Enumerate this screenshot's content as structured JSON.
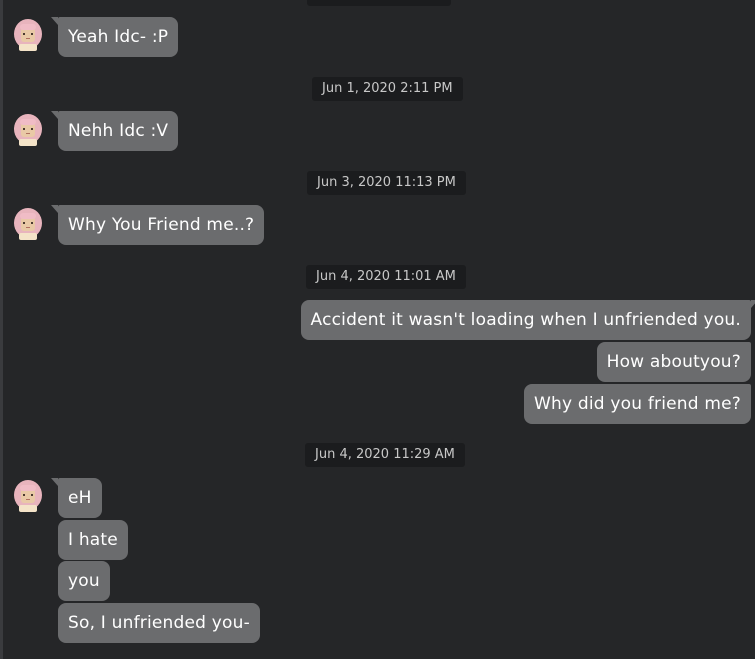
{
  "messages": {
    "m1": "Yeah Idc- :P",
    "ts2": "Jun 1, 2020 2:11 PM",
    "m2": "Nehh Idc :V",
    "ts3": "Jun 3, 2020 11:13 PM",
    "m3": "Why You Friend me..?",
    "ts4": "Jun 4, 2020 11:01 AM",
    "o1": "Accident it wasn't loading when I unfriended you.",
    "o2": "How aboutyou?",
    "o3": "Why did you friend me?",
    "ts5": "Jun 4, 2020 11:29 AM",
    "m4": "eH",
    "m5": "I hate",
    "m6": "you",
    "m7": "So, I unfriended you-"
  },
  "colors": {
    "background": "#252628",
    "bubble": "#6b6c6e",
    "timestamp_bg": "#1b1c1e",
    "avatar_hair": "#e8b4bd"
  },
  "icons": {
    "avatar": "friend-avatar-icon"
  }
}
